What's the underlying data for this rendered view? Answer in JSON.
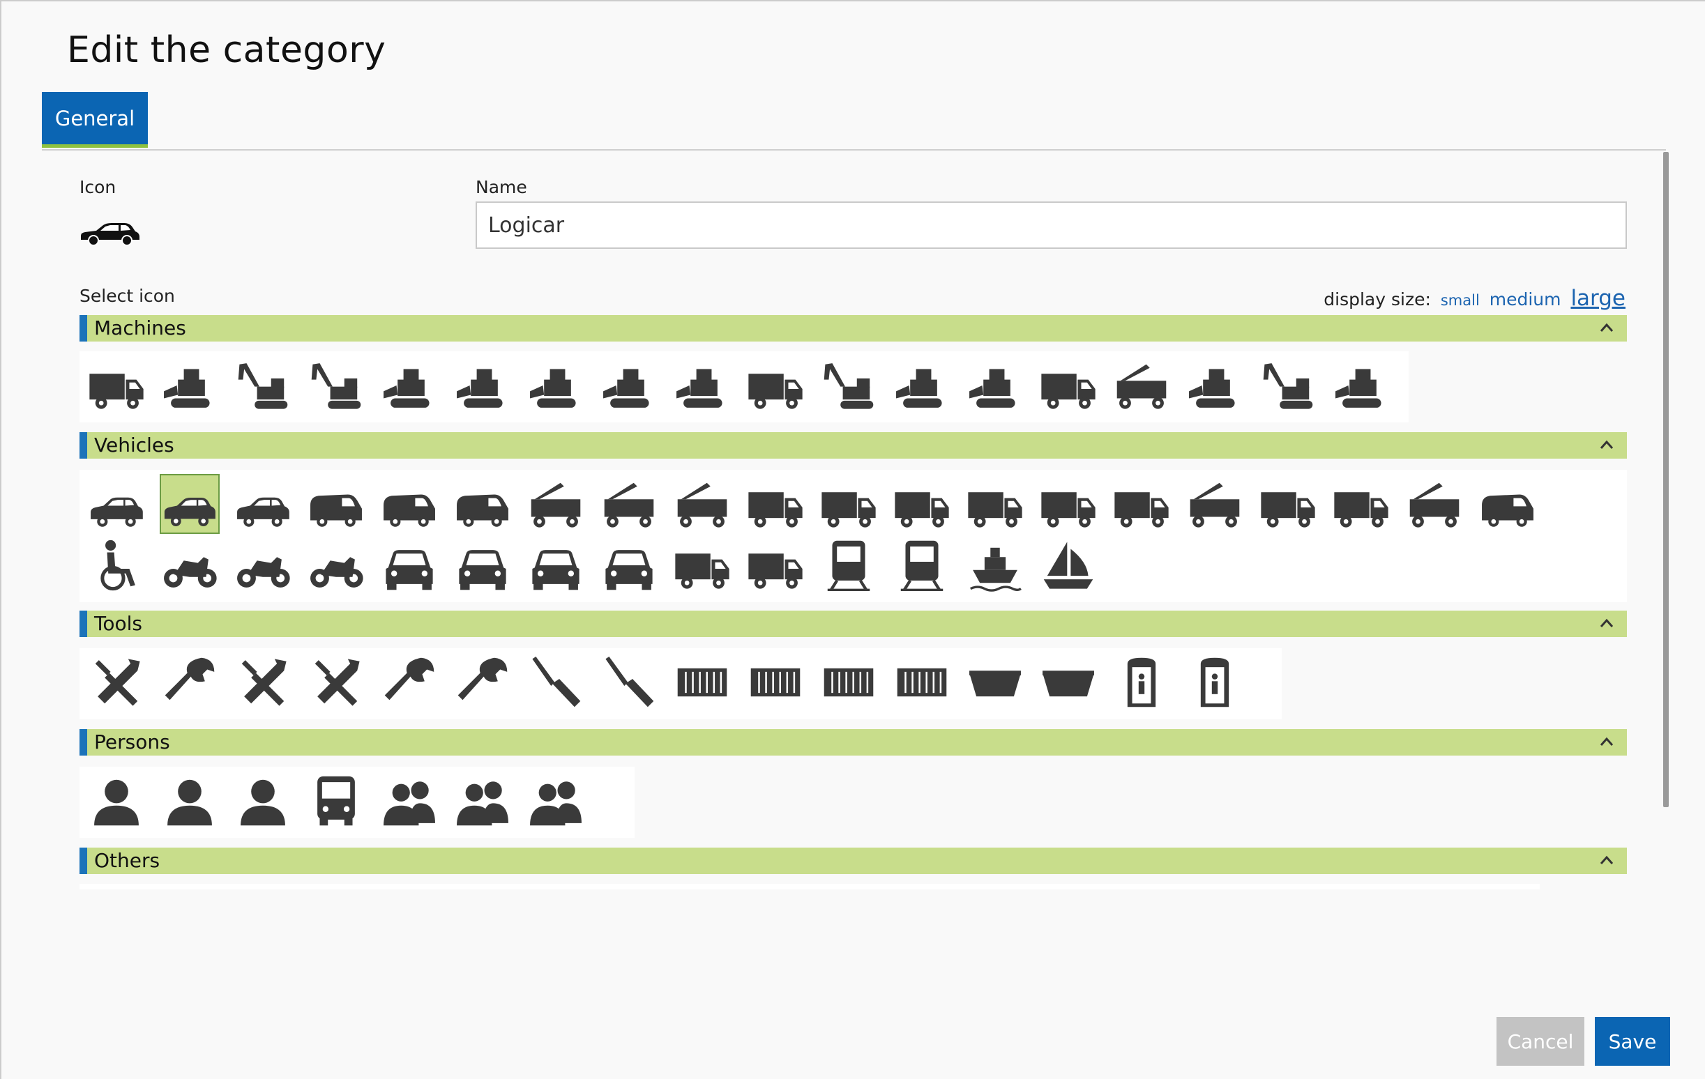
{
  "dialog": {
    "title": "Edit the category"
  },
  "tabs": [
    {
      "label": "General"
    }
  ],
  "form": {
    "icon_label": "Icon",
    "name_label": "Name",
    "name_value": "Logicar",
    "select_icon_label": "Select icon",
    "display_size_label": "display size:",
    "display_sizes": [
      "small",
      "medium",
      "large"
    ],
    "active_display_size": "large"
  },
  "selected_icon": "estate-car-icon",
  "categories": [
    {
      "label": "Machines",
      "icons": [
        "dump-truck-icon",
        "tracked-dumper-icon",
        "wheeled-excavator-icon",
        "tracked-excavator-icon",
        "road-roller-icon",
        "crawler-dozer-icon",
        "wheel-loader-icon",
        "tracked-loader-icon",
        "tractor-icon",
        "concrete-mixer-icon",
        "jumping-jack-icon",
        "plate-compactor-icon",
        "walk-behind-compactor-icon",
        "trailer-pump-icon",
        "crawler-crane-icon",
        "combine-harvester-icon",
        "telehandler-icon",
        "forklift-icon"
      ]
    },
    {
      "label": "Vehicles",
      "icons": [
        "sedan-icon",
        "estate-car-icon",
        "taxi-icon",
        "minivan-icon",
        "van-icon",
        "delivery-van-icon",
        "crane-truck-icon",
        "mobile-crane-icon",
        "truck-crane-icon",
        "tipper-truck-icon",
        "tanker-truck-icon",
        "flatbed-truck-icon",
        "box-truck-icon",
        "tow-truck-icon",
        "recovery-truck-icon",
        "low-loader-icon",
        "semi-truck-icon",
        "tanker-trailer-icon",
        "car-transporter-icon",
        "ambulance-icon",
        "wheelchair-icon",
        "motorcycle-icon",
        "scooter-icon",
        "moped-icon",
        "small-car-icon",
        "car-front-icon",
        "taxi-front-icon",
        "bus-front-icon",
        "lorry-icon",
        "cargo-truck-icon",
        "locomotive-icon",
        "train-icon",
        "ship-icon",
        "sailboat-icon"
      ]
    },
    {
      "label": "Tools",
      "icons": [
        "hammer-pick-icon",
        "hammer-wrench-icon",
        "hammer-icon",
        "mallet-icon",
        "wrench-icon",
        "spanner-icon",
        "screwdriver-icon",
        "screwdriver-alt-icon",
        "container-large-icon",
        "container-medium-icon",
        "container-small-icon",
        "skip-container-icon",
        "skip-bin-icon",
        "small-skip-icon",
        "toilet-cabin-man-icon",
        "toilet-cabin-woman-icon"
      ]
    },
    {
      "label": "Persons",
      "icons": [
        "person-icon",
        "person-female-icon",
        "person-male-icon",
        "person-business-icon",
        "two-persons-icon",
        "three-persons-icon",
        "group-icon"
      ]
    },
    {
      "label": "Others",
      "icons": []
    }
  ],
  "footer": {
    "cancel_label": "Cancel",
    "save_label": "Save"
  },
  "colors": {
    "brand_blue": "#0b65b3",
    "category_bar": "#c8dd8b",
    "accent_green": "#8fc23f",
    "icon_fill": "#3a3a3a",
    "cancel_gray": "#c3c3c3"
  }
}
